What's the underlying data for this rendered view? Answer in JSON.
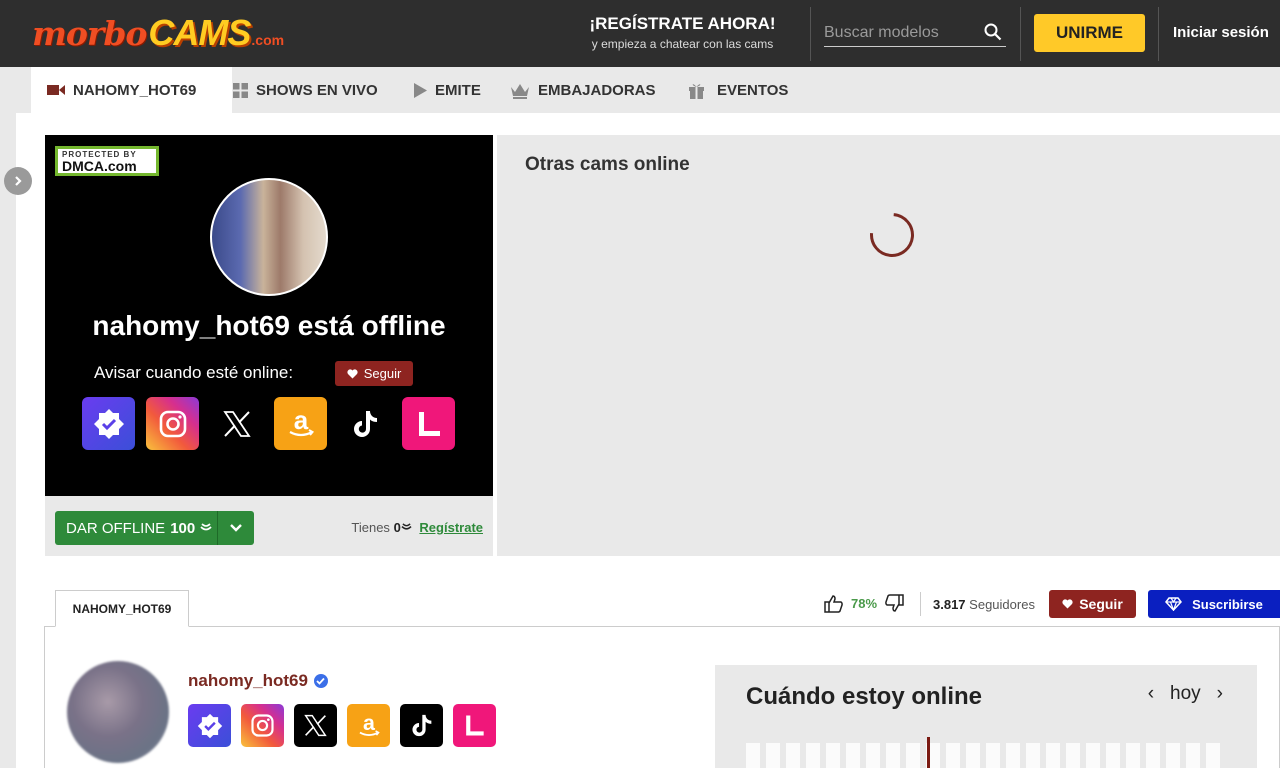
{
  "header": {
    "logo_part1": "morbo",
    "logo_part2": "CAMS",
    "logo_part3": ".com",
    "register_title": "¡REGÍSTRATE AHORA!",
    "register_sub": "y empieza a chatear con las cams",
    "search_placeholder": "Buscar modelos",
    "join_label": "UNIRME",
    "login_label": "Iniciar sesión"
  },
  "nav": {
    "items": [
      {
        "label": "NAHOMY_HOT69",
        "icon": "video-camera-icon"
      },
      {
        "label": "SHOWS EN VIVO",
        "icon": "grid-icon"
      },
      {
        "label": "EMITE",
        "icon": "play-icon"
      },
      {
        "label": "EMBAJADORAS",
        "icon": "crown-icon"
      },
      {
        "label": "EVENTOS",
        "icon": "gift-icon"
      }
    ]
  },
  "player": {
    "dmca_top": "PROTECTED BY",
    "dmca_bottom": "DMCA.com",
    "offline_title": "nahomy_hot69 está offline",
    "notify_label": "Avisar cuando esté online:",
    "follow_label": "Seguir",
    "social_icons": [
      "verified-icon",
      "instagram-icon",
      "x-icon",
      "amazon-icon",
      "tiktok-icon",
      "linktree-icon"
    ]
  },
  "controls": {
    "offline_label": "DAR OFFLINE",
    "offline_amount": "100",
    "tienes_label": "Tienes",
    "tienes_amount": "0",
    "register_link": "Regístrate"
  },
  "others": {
    "title": "Otras cams online"
  },
  "profile": {
    "tab_label": "NAHOMY_HOT69",
    "rating_pct": "78%",
    "followers_count": "3.817",
    "followers_label": "Seguidores",
    "follow_label": "Seguir",
    "subscribe_label": "Suscribirse",
    "username": "nahomy_hot69"
  },
  "schedule": {
    "title": "Cuándo estoy online",
    "day_label": "hoy"
  },
  "colors": {
    "accent_red": "#8e2420",
    "join_yellow": "#ffc928",
    "offline_green": "#2e8a3a",
    "subscribe_blue": "#0a1fc0"
  }
}
